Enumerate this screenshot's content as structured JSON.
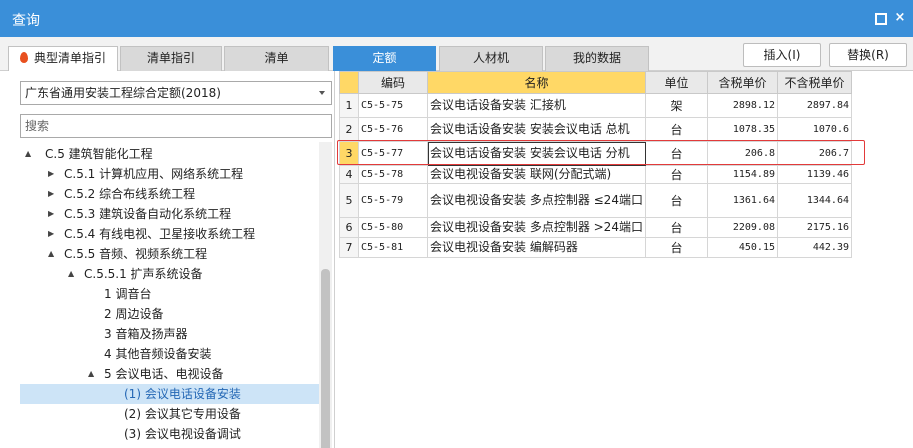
{
  "window": {
    "title": "查询",
    "restore_icon": "restore-icon",
    "close_icon": "close-icon",
    "close_glyph": "×"
  },
  "tabs": [
    {
      "label": "典型清单指引",
      "active": false,
      "icon": "fire-icon"
    },
    {
      "label": "清单指引",
      "active": false
    },
    {
      "label": "清单",
      "active": false
    },
    {
      "label": "定额",
      "active": true
    },
    {
      "label": "人材机",
      "active": false
    },
    {
      "label": "我的数据",
      "active": false
    }
  ],
  "actions": {
    "insert_label": "插入(I)",
    "replace_label": "替换(R)"
  },
  "left": {
    "quota_select": {
      "value": "广东省通用安装工程综合定额(2018)"
    },
    "search": {
      "placeholder": "搜索"
    },
    "tree": [
      {
        "label": "C.5 建筑智能化工程",
        "arrow": "▲",
        "selected": false
      },
      {
        "label": "C.5.1 计算机应用、网络系统工程",
        "arrow": "▶",
        "selected": false
      },
      {
        "label": "C.5.2 综合布线系统工程",
        "arrow": "▶",
        "selected": false
      },
      {
        "label": "C.5.3 建筑设备自动化系统工程",
        "arrow": "▶",
        "selected": false
      },
      {
        "label": "C.5.4 有线电视、卫星接收系统工程",
        "arrow": "▶",
        "selected": false
      },
      {
        "label": "C.5.5 音频、视频系统工程",
        "arrow": "▲",
        "selected": false
      },
      {
        "label": "C.5.5.1 扩声系统设备",
        "arrow": "▲",
        "selected": false
      },
      {
        "label": "1 调音台",
        "arrow": "",
        "selected": false
      },
      {
        "label": "2 周边设备",
        "arrow": "",
        "selected": false
      },
      {
        "label": "3 音箱及扬声器",
        "arrow": "",
        "selected": false
      },
      {
        "label": "4 其他音频设备安装",
        "arrow": "",
        "selected": false
      },
      {
        "label": "5 会议电话、电视设备",
        "arrow": "▲",
        "selected": false
      },
      {
        "label": "(1) 会议电话设备安装",
        "arrow": "",
        "selected": true
      },
      {
        "label": "(2) 会议其它专用设备",
        "arrow": "",
        "selected": false
      },
      {
        "label": "(3) 会议电视设备调试",
        "arrow": "",
        "selected": false
      }
    ]
  },
  "grid": {
    "headers": [
      "",
      "编码",
      "名称",
      "单位",
      "含税单价",
      "不含税单价"
    ],
    "rows": [
      {
        "idx": "1",
        "code": "C5-5-75",
        "name": "会议电话设备安装 汇接机",
        "unit": "架",
        "price_tax": "2898.12",
        "price_notax": "2897.84"
      },
      {
        "idx": "2",
        "code": "C5-5-76",
        "name": "会议电话设备安装 安装会议电话 总机",
        "unit": "台",
        "price_tax": "1078.35",
        "price_notax": "1070.6"
      },
      {
        "idx": "3",
        "code": "C5-5-77",
        "name": "会议电话设备安装 安装会议电话 分机",
        "unit": "台",
        "price_tax": "206.8",
        "price_notax": "206.7",
        "selected": true
      },
      {
        "idx": "4",
        "code": "C5-5-78",
        "name": "会议电视设备安装 联网(分配式端)",
        "unit": "台",
        "price_tax": "1154.89",
        "price_notax": "1139.46"
      },
      {
        "idx": "5",
        "code": "C5-5-79",
        "name": "会议电视设备安装 多点控制器 ≤24端口",
        "unit": "台",
        "price_tax": "1361.64",
        "price_notax": "1344.64"
      },
      {
        "idx": "6",
        "code": "C5-5-80",
        "name": "会议电视设备安装 多点控制器 >24端口",
        "unit": "台",
        "price_tax": "2209.08",
        "price_notax": "2175.16"
      },
      {
        "idx": "7",
        "code": "C5-5-81",
        "name": "会议电视设备安装 编解码器",
        "unit": "台",
        "price_tax": "450.15",
        "price_notax": "442.39"
      }
    ]
  },
  "colors": {
    "accent": "#3a8fd9",
    "selection_cell": "#ffd866",
    "highlight_border": "#e23a3a",
    "tree_selected": "#cde4f7"
  }
}
